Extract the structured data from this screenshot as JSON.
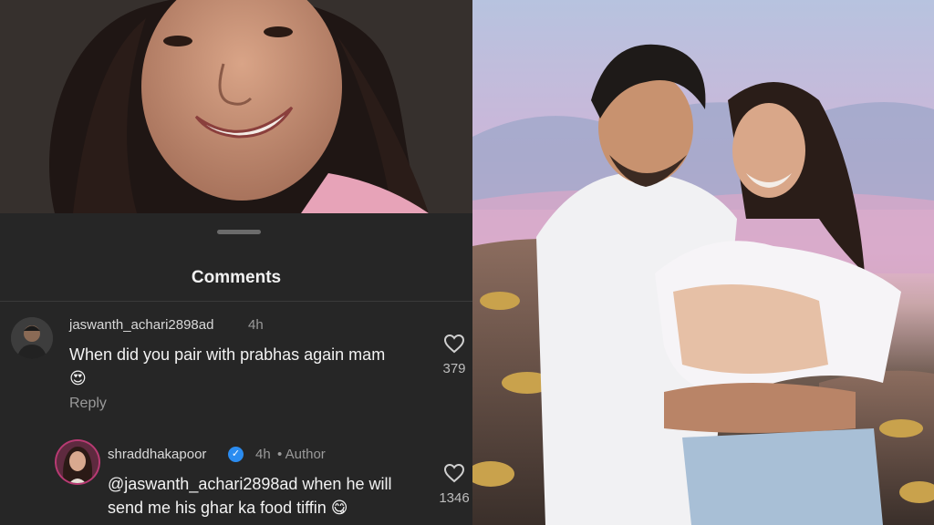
{
  "sheet": {
    "title": "Comments"
  },
  "comments": [
    {
      "username": "jaswanth_achari2898ad",
      "time": "4h",
      "text": "When did you pair with prabhas again mam😍",
      "reply_label": "Reply",
      "likes": "379"
    },
    {
      "username": "shraddhakapoor",
      "verified": true,
      "time": "4h",
      "author_label": "• Author",
      "text": "@jaswanth_achari2898ad when he will send me his ghar ka food tiffin 😋",
      "likes": "1346"
    }
  ],
  "colors": {
    "sheet_bg": "#262626",
    "verified": "#2b8cf0",
    "text": "#f2f2f2",
    "muted": "#9a9a9a"
  },
  "icons": [
    "heart-icon",
    "verified-badge-icon",
    "drag-handle-icon"
  ]
}
